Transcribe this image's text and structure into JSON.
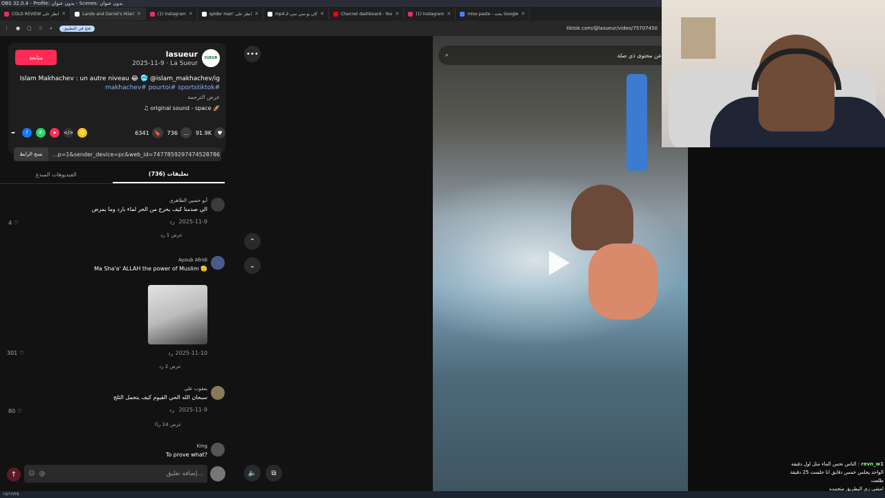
{
  "obs_title": "OBS 32.0.4 - Profile: بدون عنوان - Scenes: بدون عنوان",
  "tabs": [
    {
      "label": "COLD REVIEW انظر على",
      "color": "#e1306c"
    },
    {
      "label": "Lando and Daniel's Hilari",
      "color": "#ffffff"
    },
    {
      "label": "(1) Instagram",
      "color": "#e1306c"
    },
    {
      "label": "spider man' انظر على",
      "color": "#ffffff"
    },
    {
      "label": "mp4.2-كان يو سي سي",
      "color": "#ffffff"
    },
    {
      "label": "Channel dashboard - You",
      "color": "#ff0000"
    },
    {
      "label": "(1) Instagram",
      "color": "#e1306c"
    },
    {
      "label": "miso paste - بحث Google",
      "color": "#4285f4"
    }
  ],
  "address": {
    "open_in_app": "فتح في التطبيق",
    "url": "tiktok.com/@lasueur/video/75707450"
  },
  "post": {
    "follow_label": "متابعة",
    "author": "lasueur",
    "meta": "2025-11-9 · La Sueur",
    "avatar_text": "SUEUR",
    "description": "Islam Makhachev : un autre niveau 😂 🥶 @islam_makhachev/ig",
    "tags": "makhachev# pourtoi# sportstiktok#",
    "translate": "عرض الترجمة",
    "sound": "♫ original sound - space 🚀",
    "likes": "91.9K",
    "comments": "736",
    "saves": "6341",
    "copy_label": "نسخ الرابط",
    "link": "...p=1&sender_device=pc&web_id=7477859297474528786"
  },
  "post_tabs": {
    "videos": "الفيديوهات المبدع",
    "comments": "تعليقات (736)"
  },
  "comments": [
    {
      "name": "أبو حسين الطاهري",
      "text": "الي صدمنا كيف يخرج من الحر لماء بارد وما يمرض",
      "date": "2025-11-9",
      "reply": "رد",
      "likes": "4",
      "view_replies": "عرض 1 رد"
    },
    {
      "name": "Ayoub Afridi",
      "text": "Ma Sha'a' ALLAH the power of Muslim 🫡",
      "date": "2025-11-10",
      "reply": "رد",
      "likes": "301",
      "view_replies": "عرض 2 رد"
    },
    {
      "name": "يعقوب علي",
      "text": "سبحان الله الحي القيوم كيف يتحمل الثلج",
      "date": "2025-11-9",
      "reply": "رد",
      "likes": "80",
      "view_replies": "عرض 14 ردًا"
    },
    {
      "name": "King",
      "text": "To prove what?",
      "date": "",
      "reply": "",
      "likes": "",
      "view_replies": ""
    }
  ],
  "comment_input": {
    "placeholder": "إضافة تعليق..."
  },
  "video": {
    "search_placeholder": "ابحث عن محتوى ذي صلة"
  },
  "chat": {
    "user": "revn_w1",
    "line1": "الناس تحس الماء مثل اول دقيقة",
    "line2": "الواحد يجلس خمس دقايق انا جلست 25 دقيقة طلعت",
    "line3": "امشي زي البطريق متجمده"
  },
  "taskbar": "١٧/١٢/٢٥"
}
